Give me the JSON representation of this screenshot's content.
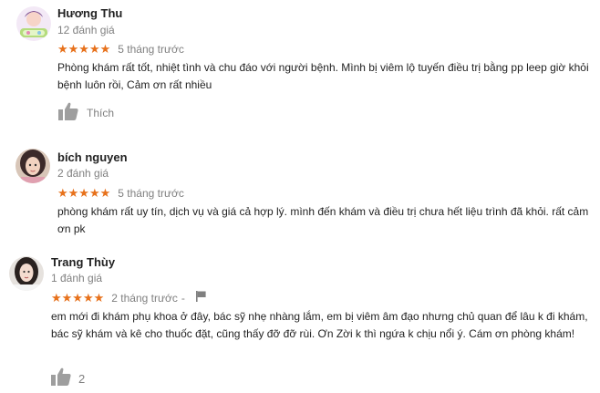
{
  "reviews": [
    {
      "author": "Hương Thu",
      "review_count": "12 đánh giá",
      "stars": "★★★★★",
      "rating": 5,
      "time": "5 tháng trước",
      "text": "Phòng khám rất tốt, nhiệt tình và chu đáo với người bệnh. Mình bị viêm lộ tuyến điều trị bằng pp leep giờ khỏi bệnh luôn rồi, Cảm ơn rất nhiều",
      "like_label": "Thích",
      "avatar_icon": "cartoon-avatar-icon"
    },
    {
      "author": "bích nguyen",
      "review_count": "2 đánh giá",
      "stars": "★★★★★",
      "rating": 5,
      "time": "5 tháng trước",
      "text": "phòng khám rất uy tín, dịch vụ và giá cả hợp lý. mình đến khám và điều trị chưa hết liệu trình đã khỏi. rất cảm ơn pk",
      "avatar_icon": "user-photo-avatar-icon"
    },
    {
      "author": "Trang Thùy",
      "review_count": "1 đánh giá",
      "stars": "★★★★★",
      "rating": 5,
      "time": "2 tháng trước",
      "separator": "-",
      "text": "em mới đi khám phụ khoa ở đây, bác sỹ nhẹ nhàng lắm, em bị viêm âm đạo nhưng chủ quan để lâu k đi khám, bác sỹ khám và kê cho thuốc đặt, cũng thấy đỡ đỡ rùi. Ơn Zời k thì ngứa k chịu nổi ý. Cám ơn phòng khám!",
      "like_count": "2",
      "avatar_icon": "user-photo-avatar-icon"
    }
  ],
  "colors": {
    "star": "#e7711b",
    "muted": "#808080",
    "text": "#222222",
    "thumb": "#9e9e9e"
  },
  "icons": {
    "thumb": "thumbs-up-icon",
    "flag": "flag-icon"
  }
}
